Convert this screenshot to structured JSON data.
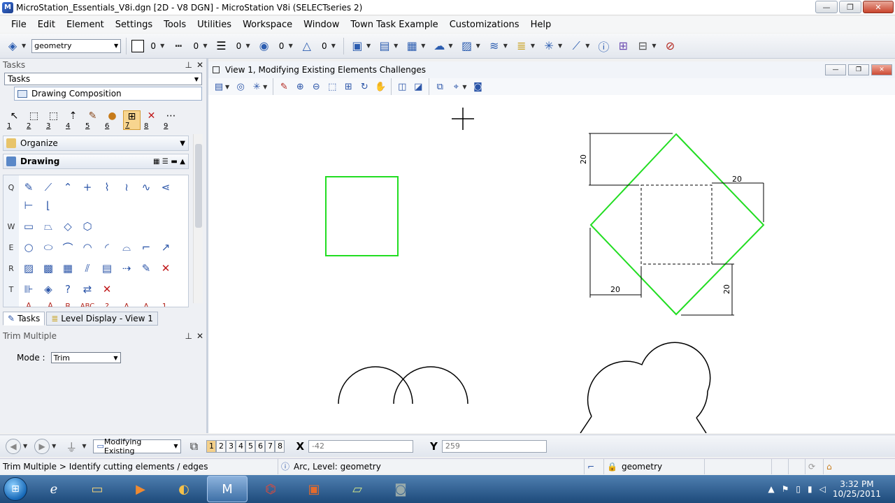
{
  "window": {
    "title": "MicroStation_Essentials_V8i.dgn [2D - V8 DGN] - MicroStation V8i (SELECTseries 2)",
    "min": "—",
    "max": "❐",
    "close": "✕"
  },
  "menu": [
    "File",
    "Edit",
    "Element",
    "Settings",
    "Tools",
    "Utilities",
    "Workspace",
    "Window",
    "Town Task Example",
    "Customizations",
    "Help"
  ],
  "attributes": {
    "level": "geometry",
    "color_value": "0",
    "style_value": "0",
    "weight_value": "0",
    "transparency_value": "0",
    "priority_value": "0"
  },
  "tasks_panel": {
    "title": "Tasks",
    "task_combo": "Tasks",
    "composition": "Drawing Composition",
    "taskset_numbers": [
      "1",
      "2",
      "3",
      "4",
      "5",
      "6",
      "7",
      "8",
      "9"
    ],
    "organize": "Organize",
    "drawing": "Drawing",
    "row_keys": [
      "Q",
      "W",
      "E",
      "R",
      "T"
    ],
    "tabs": [
      "Tasks",
      "Level Display - View 1"
    ]
  },
  "tool_settings": {
    "title": "Trim Multiple",
    "mode_label": "Mode :",
    "mode_value": "Trim"
  },
  "view": {
    "title": "View 1, Modifying Existing Elements Challenges",
    "dims": [
      "20",
      "20",
      "20",
      "20"
    ]
  },
  "statusbar": {
    "view_group": "Modifying Existing",
    "view_numbers": [
      "1",
      "2",
      "3",
      "4",
      "5",
      "6",
      "7",
      "8"
    ],
    "x_label": "X",
    "x_value": "-42",
    "y_label": "Y",
    "y_value": "259",
    "prompt": "Trim Multiple > Identify cutting elements / edges",
    "message": "Arc, Level: geometry",
    "active_level": "geometry"
  },
  "taskbar": {
    "time": "3:32 PM",
    "date": "10/25/2011"
  }
}
